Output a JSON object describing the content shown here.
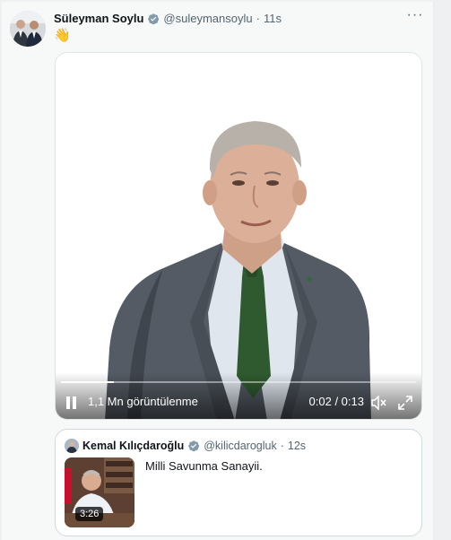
{
  "post": {
    "author_name": "Süleyman Soylu",
    "handle": "@suleymansoylu",
    "separator": "·",
    "time": "11s",
    "text": "👋",
    "more_label": "···"
  },
  "video": {
    "views_text": "1,1 Mn görüntülenme",
    "time_text": "0:02 / 0:13",
    "progress": 0.15
  },
  "quote": {
    "author_name": "Kemal Kılıçdaroğlu",
    "handle": "@kilicdarogluk",
    "separator": "·",
    "time": "12s",
    "text": "Milli Savunma Sanayii.",
    "duration": "3:26"
  },
  "colors": {
    "verified": "#829aab",
    "text_secondary": "#536471"
  },
  "icons": [
    "verified-badge-icon",
    "more-icon",
    "pause-icon",
    "volume-muted-icon",
    "fullscreen-icon"
  ]
}
